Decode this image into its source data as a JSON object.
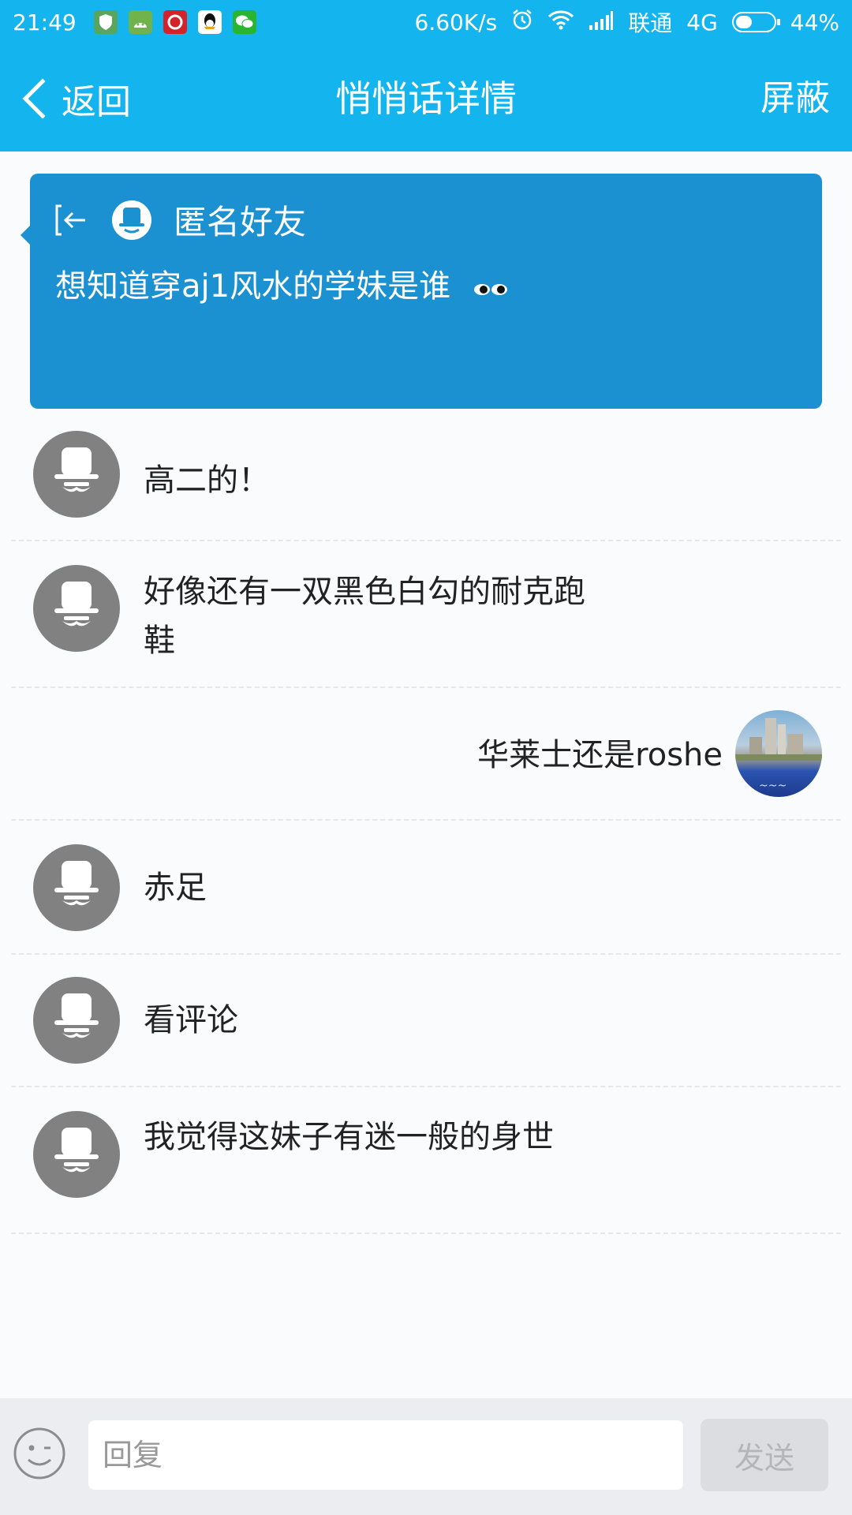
{
  "status_bar": {
    "time": "21:49",
    "speed": "6.60K/s",
    "carrier": "联通",
    "network": "4G",
    "battery": "44%",
    "battery_level": 0.44,
    "app_icons": [
      "shield-app-icon",
      "android-app-icon",
      "netease-music-icon",
      "qq-icon",
      "wechat-icon"
    ]
  },
  "nav": {
    "back_label": "返回",
    "title": "悄悄话详情",
    "action_label": "屏蔽"
  },
  "top_message": {
    "sender": "匿名好友",
    "text": "想知道穿aj1风水的学妹是谁",
    "emoji": "eyes-emoji"
  },
  "replies": [
    {
      "text": "高二的！",
      "self": false
    },
    {
      "text": "好像还有一双黑色白勾的耐克跑鞋",
      "self": false
    },
    {
      "text": "华莱士还是roshe",
      "self": true
    },
    {
      "text": "赤足",
      "self": false
    },
    {
      "text": "看评论",
      "self": false
    },
    {
      "text": "我觉得这妹子有迷一般的身世",
      "self": false
    }
  ],
  "composer": {
    "placeholder": "回复",
    "send_label": "发送"
  },
  "colors": {
    "header": "#14b4ef",
    "card": "#1b91d1",
    "anon_avatar": "#818181",
    "composer_bg": "#ebedf0"
  }
}
